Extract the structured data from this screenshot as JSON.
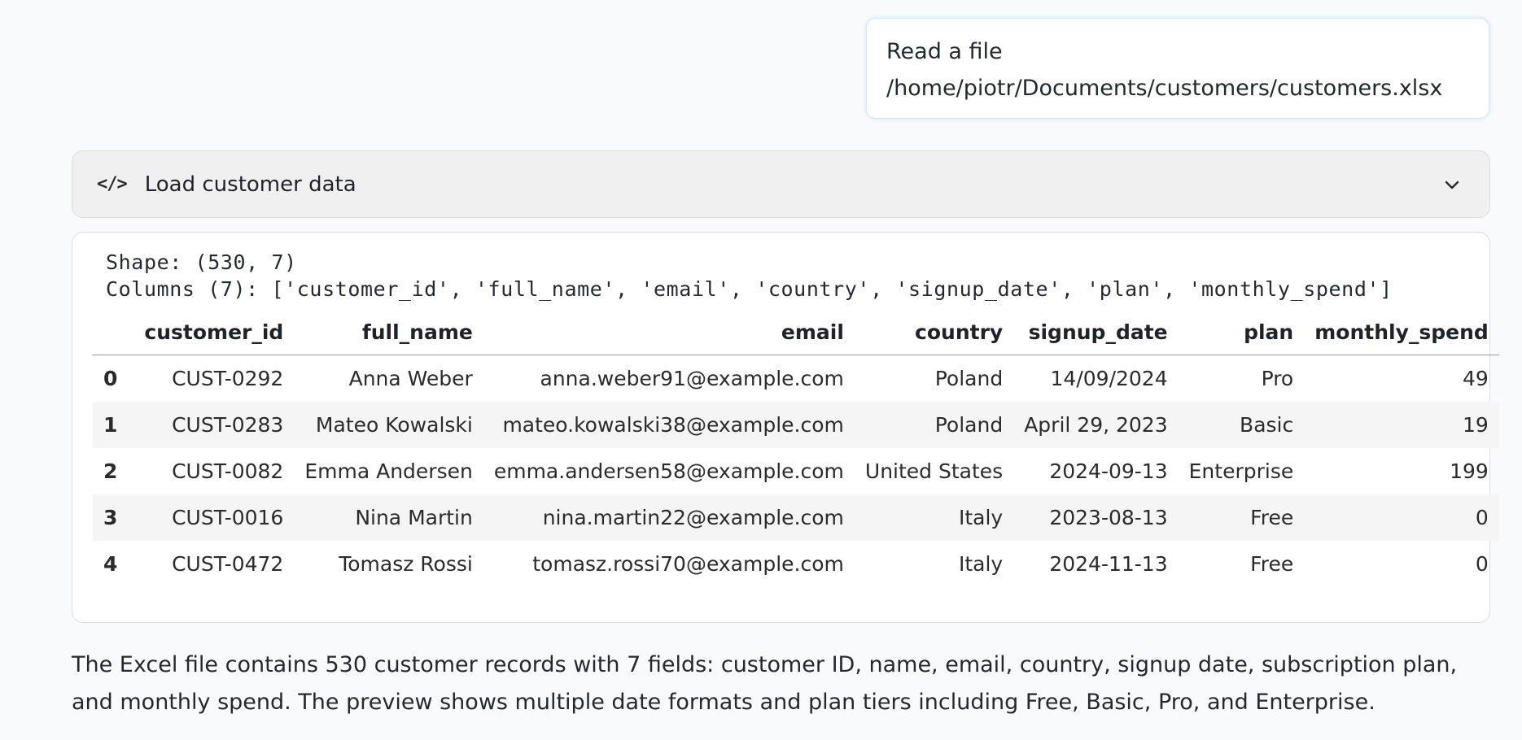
{
  "user_message": {
    "line1": "Read a file",
    "line2": "/home/piotr/Documents/customers/customers.xlsx"
  },
  "tool_call": {
    "icon": "code-icon",
    "icon_glyph": "</>",
    "title": "Load customer data",
    "expand_icon": "chevron-down-icon"
  },
  "output": {
    "shape_line": "Shape: (530, 7)",
    "columns_line": "Columns (7): ['customer_id', 'full_name', 'email', 'country', 'signup_date', 'plan', 'monthly_spend']",
    "table": {
      "headers": [
        "",
        "customer_id",
        "full_name",
        "email",
        "country",
        "signup_date",
        "plan",
        "monthly_spend"
      ],
      "rows": [
        [
          "0",
          "CUST-0292",
          "Anna Weber",
          "anna.weber91@example.com",
          "Poland",
          "14/09/2024",
          "Pro",
          "49"
        ],
        [
          "1",
          "CUST-0283",
          "Mateo Kowalski",
          "mateo.kowalski38@example.com",
          "Poland",
          "April 29, 2023",
          "Basic",
          "19"
        ],
        [
          "2",
          "CUST-0082",
          "Emma Andersen",
          "emma.andersen58@example.com",
          "United States",
          "2024-09-13",
          "Enterprise",
          "199"
        ],
        [
          "3",
          "CUST-0016",
          "Nina Martin",
          "nina.martin22@example.com",
          "Italy",
          "2023-08-13",
          "Free",
          "0"
        ],
        [
          "4",
          "CUST-0472",
          "Tomasz Rossi",
          "tomasz.rossi70@example.com",
          "Italy",
          "2024-11-13",
          "Free",
          "0"
        ]
      ]
    }
  },
  "summary": "The Excel file contains 530 customer records with 7 fields: customer ID, name, email, country, signup date, subscription plan, and monthly spend. The preview shows multiple date formats and plan tiers including Free, Basic, Pro, and Enterprise.",
  "colors": {
    "page_background": "#f9fafc",
    "tool_header_background": "#f0f0f0",
    "user_message_border": "#d5e7f2"
  }
}
